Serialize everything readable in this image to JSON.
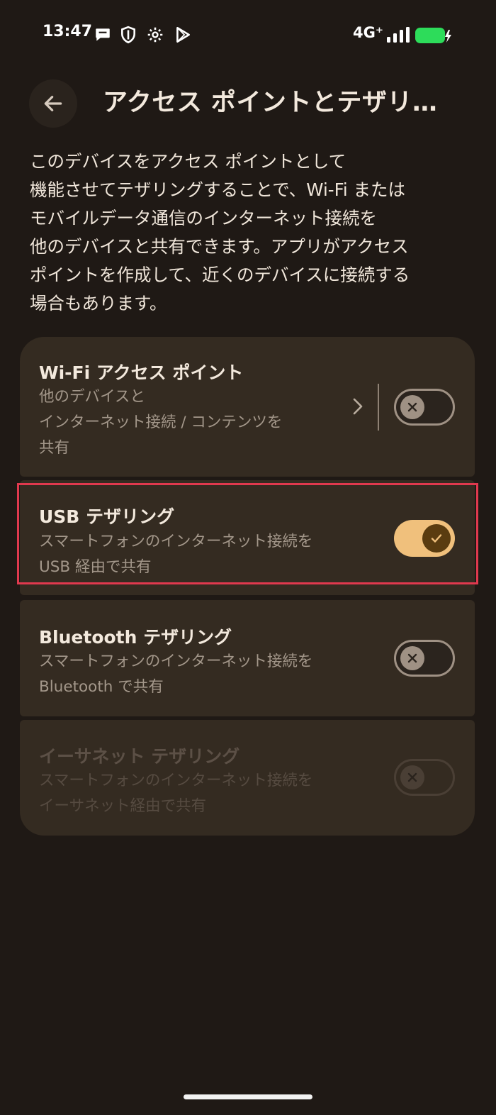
{
  "status_bar": {
    "time": "13:47",
    "network": "4G⁺",
    "icons": [
      "chat-bubble-icon",
      "shield-icon",
      "gear-icon",
      "play-store-icon",
      "signal-icon",
      "battery-charging-icon"
    ]
  },
  "header": {
    "back_icon": "back-arrow-icon",
    "title": "アクセス ポイントとテザリ…"
  },
  "description": "このデバイスをアクセス ポイントとして\n機能させてテザリングすることで、Wi-Fi または\nモバイルデータ通信のインターネット接続を\n他のデバイスと共有できます。アプリがアクセス\nポイントを作成して、近くのデバイスに接続する\n場合もあります。",
  "items": [
    {
      "title": "Wi-Fi アクセス ポイント",
      "subtitle": "他のデバイスと\nインターネット接続 / コンテンツを\n共有",
      "enabled": true,
      "toggle": "off"
    },
    {
      "title": "USB テザリング",
      "subtitle": "スマートフォンのインターネット接続を\nUSB 経由で共有",
      "enabled": true,
      "toggle": "on"
    },
    {
      "title": "Bluetooth テザリング",
      "subtitle": "スマートフォンのインターネット接続を\nBluetooth で共有",
      "enabled": true,
      "toggle": "off"
    },
    {
      "title": "イーサネット テザリング",
      "subtitle": "スマートフォンのインターネット接続を\nイーサネット経由で共有",
      "enabled": false,
      "toggle": "off"
    }
  ],
  "colors": {
    "background": "#1f1915",
    "card": "#342b21",
    "accent": "#f0c07c",
    "highlight": "#e0394e",
    "battery": "#2ddc5a"
  }
}
